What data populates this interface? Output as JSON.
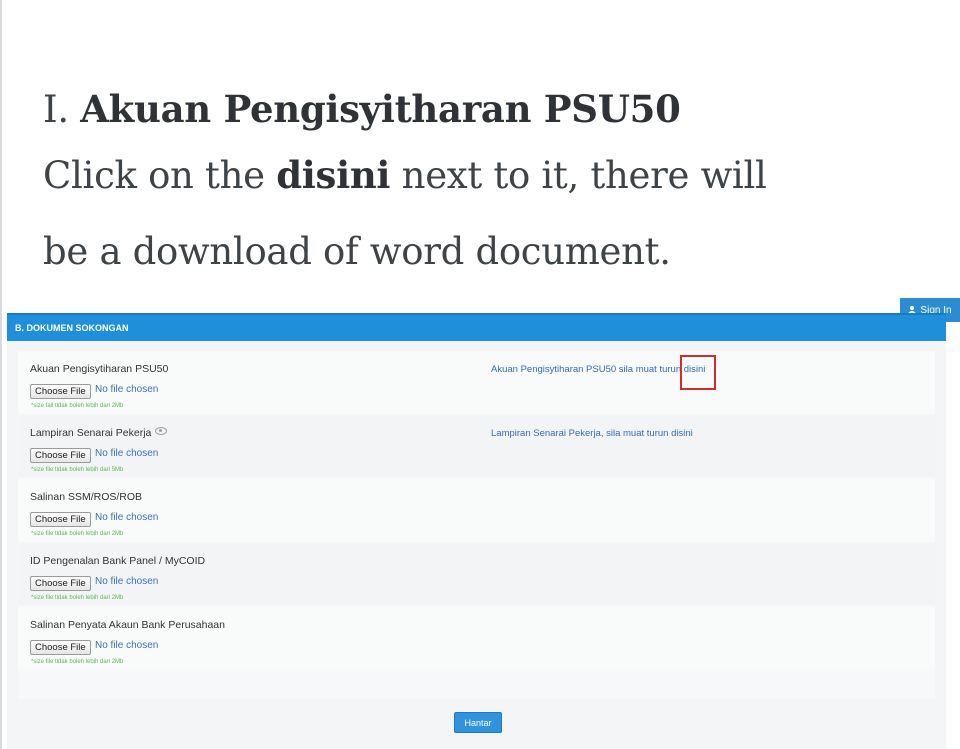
{
  "instructions": {
    "line1_prefix": "I.",
    "line1_bold": "Akuan Pengisyitharan PSU50",
    "line2_pre": "Click on the",
    "line2_bold": "disini",
    "line2_post": "next to it, there will",
    "line3": "be a download of word document."
  },
  "header": {
    "sign_in_label": "Sign In"
  },
  "section": {
    "title": "B. DOKUMEN SOKONGAN"
  },
  "fields": [
    {
      "label": "Akuan Pengisytiharan PSU50",
      "button": "Choose File",
      "status": "No file chosen",
      "note": "*size fail tidak boleh lebih dari 2Mb",
      "download_text": "Akuan Pengisytiharan PSU50 sila muat turun",
      "download_link": "disini"
    },
    {
      "label": "Lampiran Senarai Pekerja",
      "button": "Choose File",
      "status": "No file chosen",
      "note": "*size file tidak boleh lebih dari 5Mb",
      "download_text": "Lampiran Senarai Pekerja, sila muat turun",
      "download_link": "disini"
    },
    {
      "label": "Salinan SSM/ROS/ROB",
      "button": "Choose File",
      "status": "No file chosen",
      "note": "*size file tidak boleh lebih dari 2Mb"
    },
    {
      "label": "ID Pengenalan Bank Panel / MyCOID",
      "button": "Choose File",
      "status": "No file chosen",
      "note": "*size file tidak boleh lebih dari 2Mb"
    },
    {
      "label": "Salinan Penyata Akaun Bank Perusahaan",
      "button": "Choose File",
      "status": "No file chosen",
      "note": "*size file tidak boleh lebih dari 2Mb"
    }
  ],
  "submit": {
    "label": "Hantar"
  },
  "icons": {
    "sign_in": "user-icon",
    "info": "eye-icon"
  },
  "colors": {
    "header_blue": "#1f8fdc",
    "link_blue": "#2f6db5",
    "note_green": "#5cb85c",
    "highlight_red": "#d22b2b"
  }
}
